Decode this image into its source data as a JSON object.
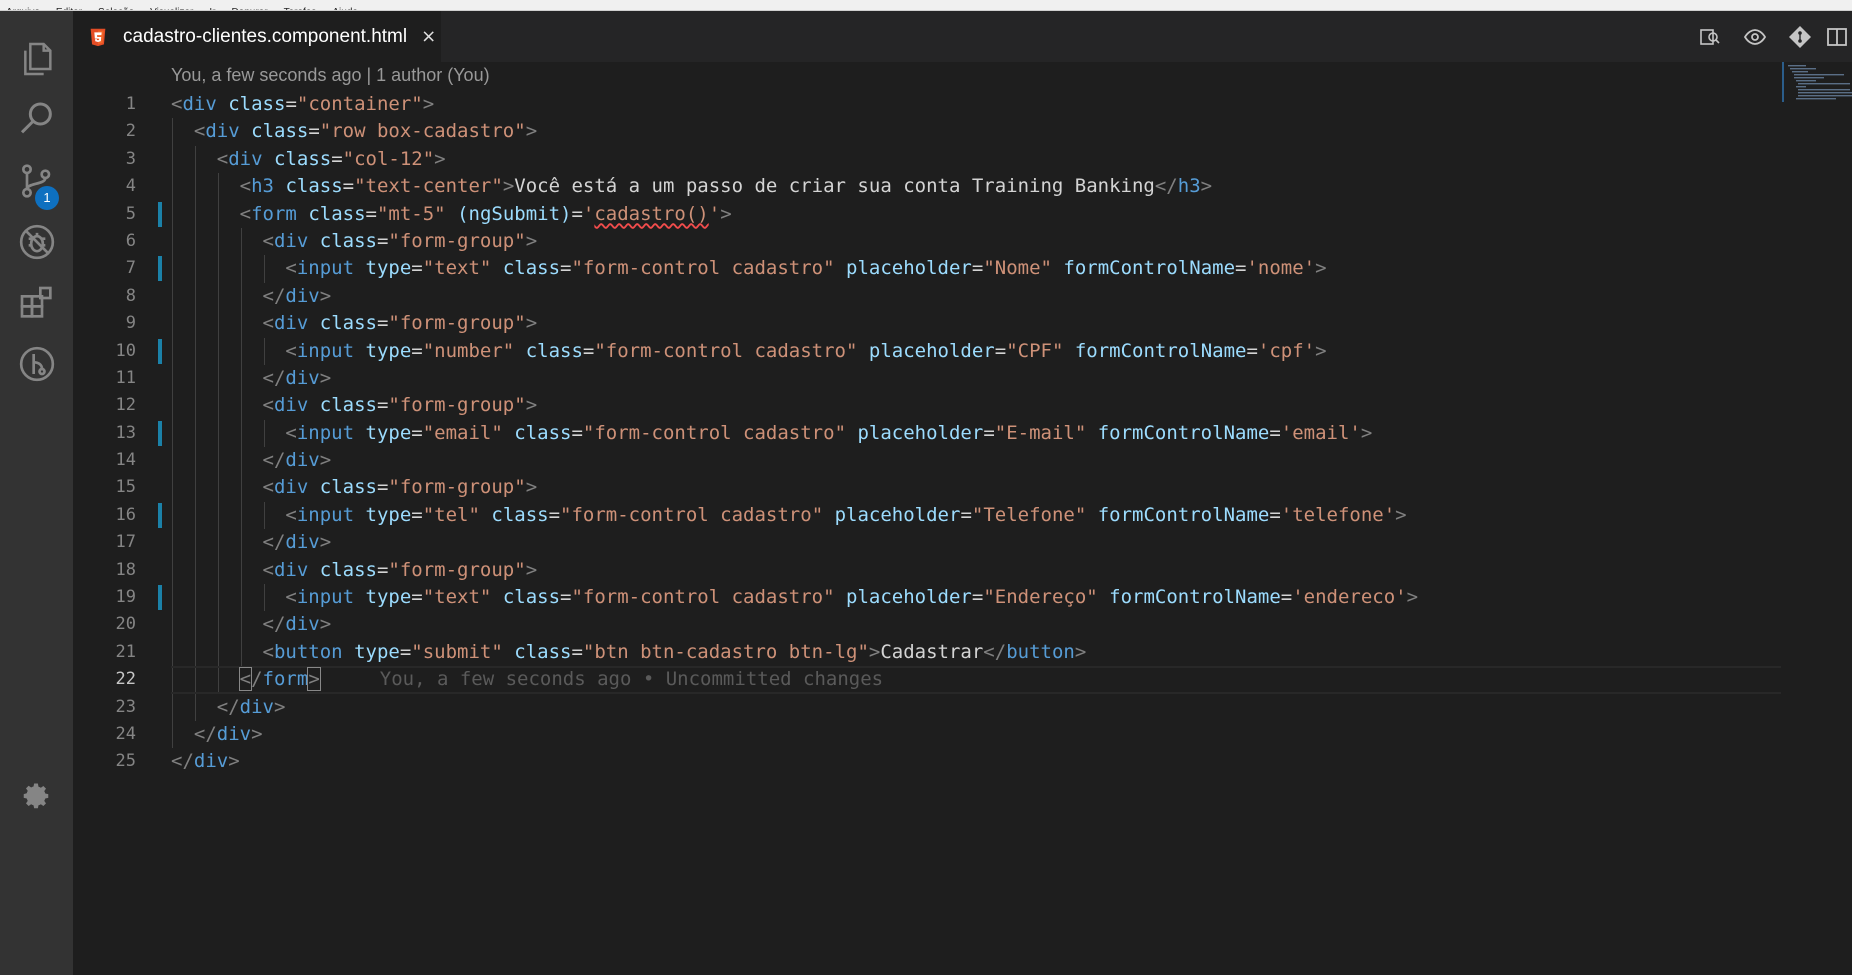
{
  "menu": {
    "items": [
      "Arquivo",
      "Editar",
      "Seleção",
      "Visualizar",
      "Ir",
      "Depurar",
      "Tarefas",
      "Ajuda"
    ]
  },
  "activity_bar": {
    "items": [
      {
        "name": "explorer",
        "icon": "files-icon"
      },
      {
        "name": "search",
        "icon": "search-icon"
      },
      {
        "name": "source-control",
        "icon": "git-branch-icon",
        "badge": "1"
      },
      {
        "name": "debug",
        "icon": "no-bug-icon"
      },
      {
        "name": "extensions",
        "icon": "extensions-icon"
      },
      {
        "name": "gitlens",
        "icon": "gitlens-icon"
      }
    ],
    "settings_icon": "gear-icon"
  },
  "tab": {
    "file_name": "cadastro-clientes.component.html",
    "icon": "html5-icon",
    "close": "×",
    "icon_color": "#e44d26"
  },
  "editor_actions": [
    "open-changes-icon",
    "toggle-blame-icon",
    "git-compare-icon",
    "split-editor-icon"
  ],
  "codelens": "You, a few seconds ago | 1 author (You)",
  "blame_inline": "You, a few seconds ago • Uncommitted changes",
  "active_line": 22,
  "modified_lines": [
    5,
    7,
    10,
    13,
    16,
    19
  ],
  "lines": [
    {
      "n": "1",
      "indent": 0,
      "tokens": [
        [
          "br",
          "<"
        ],
        [
          "tag",
          "div"
        ],
        [
          "txt",
          " "
        ],
        [
          "attr",
          "class"
        ],
        [
          "eq",
          "="
        ],
        [
          "str",
          "\"container\""
        ],
        [
          "br",
          ">"
        ]
      ]
    },
    {
      "n": "2",
      "indent": 1,
      "tokens": [
        [
          "br",
          "<"
        ],
        [
          "tag",
          "div"
        ],
        [
          "txt",
          " "
        ],
        [
          "attr",
          "class"
        ],
        [
          "eq",
          "="
        ],
        [
          "str",
          "\"row box-cadastro\""
        ],
        [
          "br",
          ">"
        ]
      ]
    },
    {
      "n": "3",
      "indent": 2,
      "tokens": [
        [
          "br",
          "<"
        ],
        [
          "tag",
          "div"
        ],
        [
          "txt",
          " "
        ],
        [
          "attr",
          "class"
        ],
        [
          "eq",
          "="
        ],
        [
          "str",
          "\"col-12\""
        ],
        [
          "br",
          ">"
        ]
      ]
    },
    {
      "n": "4",
      "indent": 3,
      "tokens": [
        [
          "br",
          "<"
        ],
        [
          "tag",
          "h3"
        ],
        [
          "txt",
          " "
        ],
        [
          "attr",
          "class"
        ],
        [
          "eq",
          "="
        ],
        [
          "str",
          "\"text-center\""
        ],
        [
          "br",
          ">"
        ],
        [
          "txt",
          "Você está a um passo de criar sua conta Training Banking"
        ],
        [
          "br",
          "</"
        ],
        [
          "tag",
          "h3"
        ],
        [
          "br",
          ">"
        ]
      ]
    },
    {
      "n": "5",
      "indent": 3,
      "tokens": [
        [
          "br",
          "<"
        ],
        [
          "tag",
          "form"
        ],
        [
          "txt",
          " "
        ],
        [
          "attr",
          "class"
        ],
        [
          "eq",
          "="
        ],
        [
          "str",
          "\"mt-5\""
        ],
        [
          "txt",
          " "
        ],
        [
          "attr",
          "(ngSubmit)"
        ],
        [
          "eq",
          "="
        ],
        [
          "str",
          "'"
        ],
        [
          "strsq",
          "cadastro()"
        ],
        [
          "str",
          "'"
        ],
        [
          "br",
          ">"
        ]
      ]
    },
    {
      "n": "6",
      "indent": 4,
      "tokens": [
        [
          "br",
          "<"
        ],
        [
          "tag",
          "div"
        ],
        [
          "txt",
          " "
        ],
        [
          "attr",
          "class"
        ],
        [
          "eq",
          "="
        ],
        [
          "str",
          "\"form-group\""
        ],
        [
          "br",
          ">"
        ]
      ]
    },
    {
      "n": "7",
      "indent": 5,
      "tokens": [
        [
          "br",
          "<"
        ],
        [
          "tag",
          "input"
        ],
        [
          "txt",
          " "
        ],
        [
          "attr",
          "type"
        ],
        [
          "eq",
          "="
        ],
        [
          "str",
          "\"text\""
        ],
        [
          "txt",
          " "
        ],
        [
          "attr",
          "class"
        ],
        [
          "eq",
          "="
        ],
        [
          "str",
          "\"form-control cadastro\""
        ],
        [
          "txt",
          " "
        ],
        [
          "attr",
          "placeholder"
        ],
        [
          "eq",
          "="
        ],
        [
          "str",
          "\"Nome\""
        ],
        [
          "txt",
          " "
        ],
        [
          "attr",
          "formControlName"
        ],
        [
          "eq",
          "="
        ],
        [
          "str",
          "'nome'"
        ],
        [
          "br",
          ">"
        ]
      ]
    },
    {
      "n": "8",
      "indent": 4,
      "tokens": [
        [
          "br",
          "</"
        ],
        [
          "tag",
          "div"
        ],
        [
          "br",
          ">"
        ]
      ]
    },
    {
      "n": "9",
      "indent": 4,
      "tokens": [
        [
          "br",
          "<"
        ],
        [
          "tag",
          "div"
        ],
        [
          "txt",
          " "
        ],
        [
          "attr",
          "class"
        ],
        [
          "eq",
          "="
        ],
        [
          "str",
          "\"form-group\""
        ],
        [
          "br",
          ">"
        ]
      ]
    },
    {
      "n": "10",
      "indent": 5,
      "tokens": [
        [
          "br",
          "<"
        ],
        [
          "tag",
          "input"
        ],
        [
          "txt",
          " "
        ],
        [
          "attr",
          "type"
        ],
        [
          "eq",
          "="
        ],
        [
          "str",
          "\"number\""
        ],
        [
          "txt",
          " "
        ],
        [
          "attr",
          "class"
        ],
        [
          "eq",
          "="
        ],
        [
          "str",
          "\"form-control cadastro\""
        ],
        [
          "txt",
          " "
        ],
        [
          "attr",
          "placeholder"
        ],
        [
          "eq",
          "="
        ],
        [
          "str",
          "\"CPF\""
        ],
        [
          "txt",
          " "
        ],
        [
          "attr",
          "formControlName"
        ],
        [
          "eq",
          "="
        ],
        [
          "str",
          "'cpf'"
        ],
        [
          "br",
          ">"
        ]
      ]
    },
    {
      "n": "11",
      "indent": 4,
      "tokens": [
        [
          "br",
          "</"
        ],
        [
          "tag",
          "div"
        ],
        [
          "br",
          ">"
        ]
      ]
    },
    {
      "n": "12",
      "indent": 4,
      "tokens": [
        [
          "br",
          "<"
        ],
        [
          "tag",
          "div"
        ],
        [
          "txt",
          " "
        ],
        [
          "attr",
          "class"
        ],
        [
          "eq",
          "="
        ],
        [
          "str",
          "\"form-group\""
        ],
        [
          "br",
          ">"
        ]
      ]
    },
    {
      "n": "13",
      "indent": 5,
      "tokens": [
        [
          "br",
          "<"
        ],
        [
          "tag",
          "input"
        ],
        [
          "txt",
          " "
        ],
        [
          "attr",
          "type"
        ],
        [
          "eq",
          "="
        ],
        [
          "str",
          "\"email\""
        ],
        [
          "txt",
          " "
        ],
        [
          "attr",
          "class"
        ],
        [
          "eq",
          "="
        ],
        [
          "str",
          "\"form-control cadastro\""
        ],
        [
          "txt",
          " "
        ],
        [
          "attr",
          "placeholder"
        ],
        [
          "eq",
          "="
        ],
        [
          "str",
          "\"E-mail\""
        ],
        [
          "txt",
          " "
        ],
        [
          "attr",
          "formControlName"
        ],
        [
          "eq",
          "="
        ],
        [
          "str",
          "'email'"
        ],
        [
          "br",
          ">"
        ]
      ]
    },
    {
      "n": "14",
      "indent": 4,
      "tokens": [
        [
          "br",
          "</"
        ],
        [
          "tag",
          "div"
        ],
        [
          "br",
          ">"
        ]
      ]
    },
    {
      "n": "15",
      "indent": 4,
      "tokens": [
        [
          "br",
          "<"
        ],
        [
          "tag",
          "div"
        ],
        [
          "txt",
          " "
        ],
        [
          "attr",
          "class"
        ],
        [
          "eq",
          "="
        ],
        [
          "str",
          "\"form-group\""
        ],
        [
          "br",
          ">"
        ]
      ]
    },
    {
      "n": "16",
      "indent": 5,
      "tokens": [
        [
          "br",
          "<"
        ],
        [
          "tag",
          "input"
        ],
        [
          "txt",
          " "
        ],
        [
          "attr",
          "type"
        ],
        [
          "eq",
          "="
        ],
        [
          "str",
          "\"tel\""
        ],
        [
          "txt",
          " "
        ],
        [
          "attr",
          "class"
        ],
        [
          "eq",
          "="
        ],
        [
          "str",
          "\"form-control cadastro\""
        ],
        [
          "txt",
          " "
        ],
        [
          "attr",
          "placeholder"
        ],
        [
          "eq",
          "="
        ],
        [
          "str",
          "\"Telefone\""
        ],
        [
          "txt",
          " "
        ],
        [
          "attr",
          "formControlName"
        ],
        [
          "eq",
          "="
        ],
        [
          "str",
          "'telefone'"
        ],
        [
          "br",
          ">"
        ]
      ]
    },
    {
      "n": "17",
      "indent": 4,
      "tokens": [
        [
          "br",
          "</"
        ],
        [
          "tag",
          "div"
        ],
        [
          "br",
          ">"
        ]
      ]
    },
    {
      "n": "18",
      "indent": 4,
      "tokens": [
        [
          "br",
          "<"
        ],
        [
          "tag",
          "div"
        ],
        [
          "txt",
          " "
        ],
        [
          "attr",
          "class"
        ],
        [
          "eq",
          "="
        ],
        [
          "str",
          "\"form-group\""
        ],
        [
          "br",
          ">"
        ]
      ]
    },
    {
      "n": "19",
      "indent": 5,
      "tokens": [
        [
          "br",
          "<"
        ],
        [
          "tag",
          "input"
        ],
        [
          "txt",
          " "
        ],
        [
          "attr",
          "type"
        ],
        [
          "eq",
          "="
        ],
        [
          "str",
          "\"text\""
        ],
        [
          "txt",
          " "
        ],
        [
          "attr",
          "class"
        ],
        [
          "eq",
          "="
        ],
        [
          "str",
          "\"form-control cadastro\""
        ],
        [
          "txt",
          " "
        ],
        [
          "attr",
          "placeholder"
        ],
        [
          "eq",
          "="
        ],
        [
          "str",
          "\"Endereço\""
        ],
        [
          "txt",
          " "
        ],
        [
          "attr",
          "formControlName"
        ],
        [
          "eq",
          "="
        ],
        [
          "str",
          "'endereco'"
        ],
        [
          "br",
          ">"
        ]
      ]
    },
    {
      "n": "20",
      "indent": 4,
      "tokens": [
        [
          "br",
          "</"
        ],
        [
          "tag",
          "div"
        ],
        [
          "br",
          ">"
        ]
      ]
    },
    {
      "n": "21",
      "indent": 4,
      "tokens": [
        [
          "br",
          "<"
        ],
        [
          "tag",
          "button"
        ],
        [
          "txt",
          " "
        ],
        [
          "attr",
          "type"
        ],
        [
          "eq",
          "="
        ],
        [
          "str",
          "\"submit\""
        ],
        [
          "txt",
          " "
        ],
        [
          "attr",
          "class"
        ],
        [
          "eq",
          "="
        ],
        [
          "str",
          "\"btn btn-cadastro btn-lg\""
        ],
        [
          "br",
          ">"
        ],
        [
          "txt",
          "Cadastrar"
        ],
        [
          "br",
          "</"
        ],
        [
          "tag",
          "button"
        ],
        [
          "br",
          ">"
        ]
      ]
    },
    {
      "n": "22",
      "indent": 3,
      "tokens": [
        [
          "brbox",
          "<"
        ],
        [
          "br",
          "/"
        ],
        [
          "tag",
          "form"
        ],
        [
          "brbox",
          ">"
        ]
      ]
    },
    {
      "n": "23",
      "indent": 2,
      "tokens": [
        [
          "br",
          "</"
        ],
        [
          "tag",
          "div"
        ],
        [
          "br",
          ">"
        ]
      ]
    },
    {
      "n": "24",
      "indent": 1,
      "tokens": [
        [
          "br",
          "</"
        ],
        [
          "tag",
          "div"
        ],
        [
          "br",
          ">"
        ]
      ]
    },
    {
      "n": "25",
      "indent": 0,
      "tokens": [
        [
          "br",
          "</"
        ],
        [
          "tag",
          "div"
        ],
        [
          "br",
          ">"
        ]
      ]
    }
  ]
}
